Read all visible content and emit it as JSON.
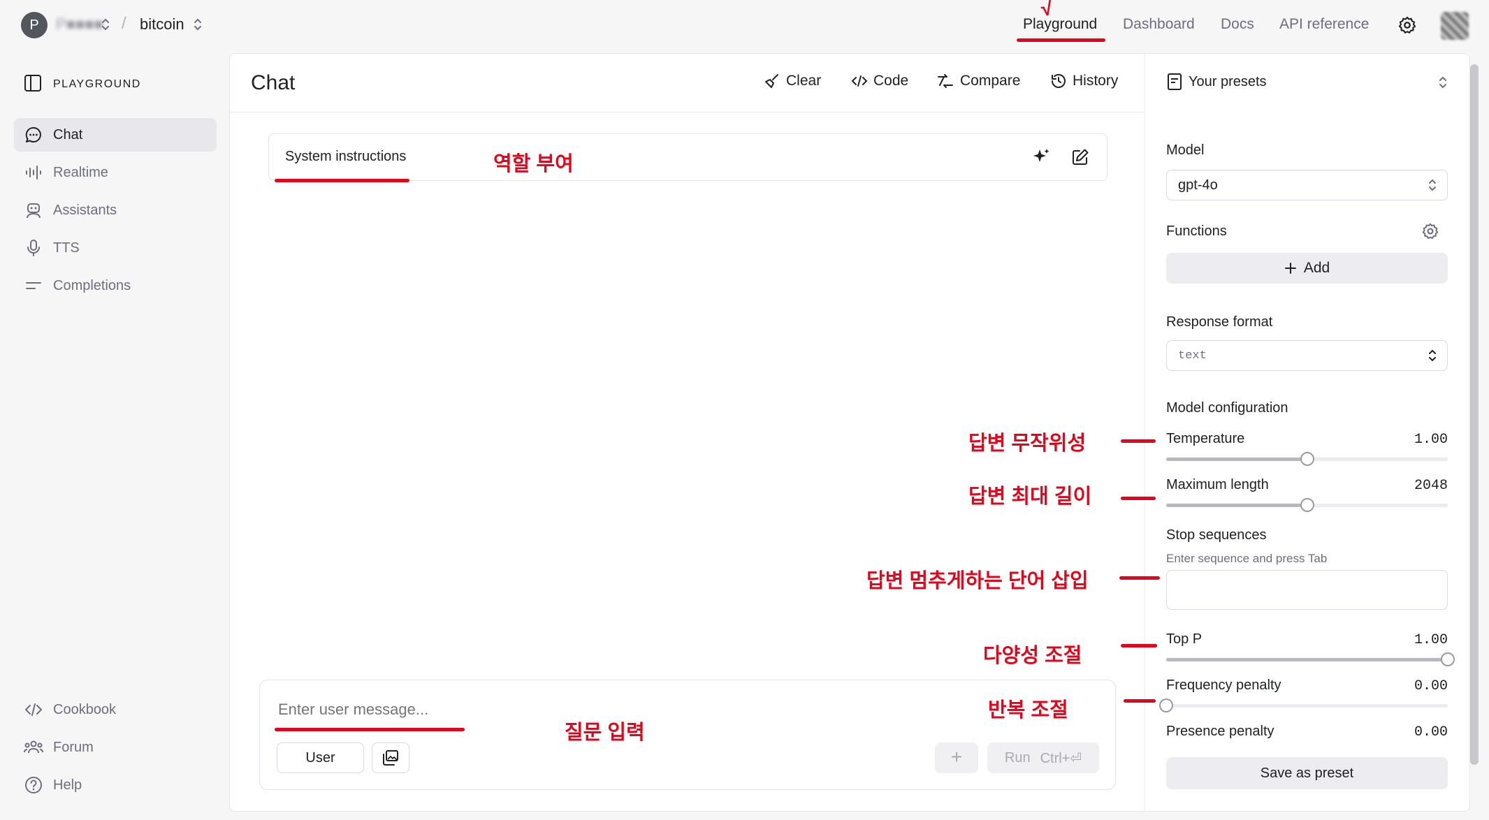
{
  "topbar": {
    "org_initial": "P",
    "org_name": "P■■■■",
    "separator": "/",
    "project_name": "bitcoin",
    "nav": [
      "Playground",
      "Dashboard",
      "Docs",
      "API reference"
    ],
    "active_nav": "Playground",
    "check_annotation": "√"
  },
  "sidebar": {
    "section_title": "PLAYGROUND",
    "items": [
      {
        "label": "Chat",
        "icon": "chat-bubble-icon",
        "active": true
      },
      {
        "label": "Realtime",
        "icon": "audio-wave-icon"
      },
      {
        "label": "Assistants",
        "icon": "robot-icon"
      },
      {
        "label": "TTS",
        "icon": "microphone-icon"
      },
      {
        "label": "Completions",
        "icon": "lines-icon"
      }
    ],
    "footer": [
      {
        "label": "Cookbook",
        "icon": "code-icon"
      },
      {
        "label": "Forum",
        "icon": "people-icon"
      },
      {
        "label": "Help",
        "icon": "question-icon"
      }
    ]
  },
  "main": {
    "title": "Chat",
    "toolbar": {
      "clear": "Clear",
      "code": "Code",
      "compare": "Compare",
      "history": "History"
    },
    "system_instructions": "System instructions",
    "composer": {
      "placeholder": "Enter user message...",
      "role": "User",
      "plus": "+",
      "run": "Run",
      "shortcut": "Ctrl+⏎"
    }
  },
  "right_panel": {
    "presets": "Your presets",
    "model_label": "Model",
    "model_value": "gpt-4o",
    "functions_label": "Functions",
    "add_label": "Add",
    "response_format_label": "Response format",
    "response_format_value": "text",
    "config_label": "Model configuration",
    "temperature": {
      "label": "Temperature",
      "value": "1.00",
      "fill": 0.5
    },
    "max_length": {
      "label": "Maximum length",
      "value": "2048",
      "fill": 0.5
    },
    "stop_sequences": {
      "label": "Stop sequences",
      "hint": "Enter sequence and press Tab"
    },
    "top_p": {
      "label": "Top P",
      "value": "1.00",
      "fill": 1.0
    },
    "frequency_penalty": {
      "label": "Frequency penalty",
      "value": "0.00",
      "fill": 0.0
    },
    "presence_penalty": {
      "label": "Presence penalty",
      "value": "0.00"
    },
    "save_preset": "Save as preset"
  },
  "annotations": {
    "role": "역할 부여",
    "question": "질문 입력",
    "temperature": "답변 무작위성",
    "max_length": "답변 최대 길이",
    "stop": "답변 멈추게하는 단어 삽입",
    "top_p": "다양성 조절",
    "penalty": "반복 조절"
  },
  "colors": {
    "annotation": "#e0061b",
    "accent": "#202123"
  }
}
